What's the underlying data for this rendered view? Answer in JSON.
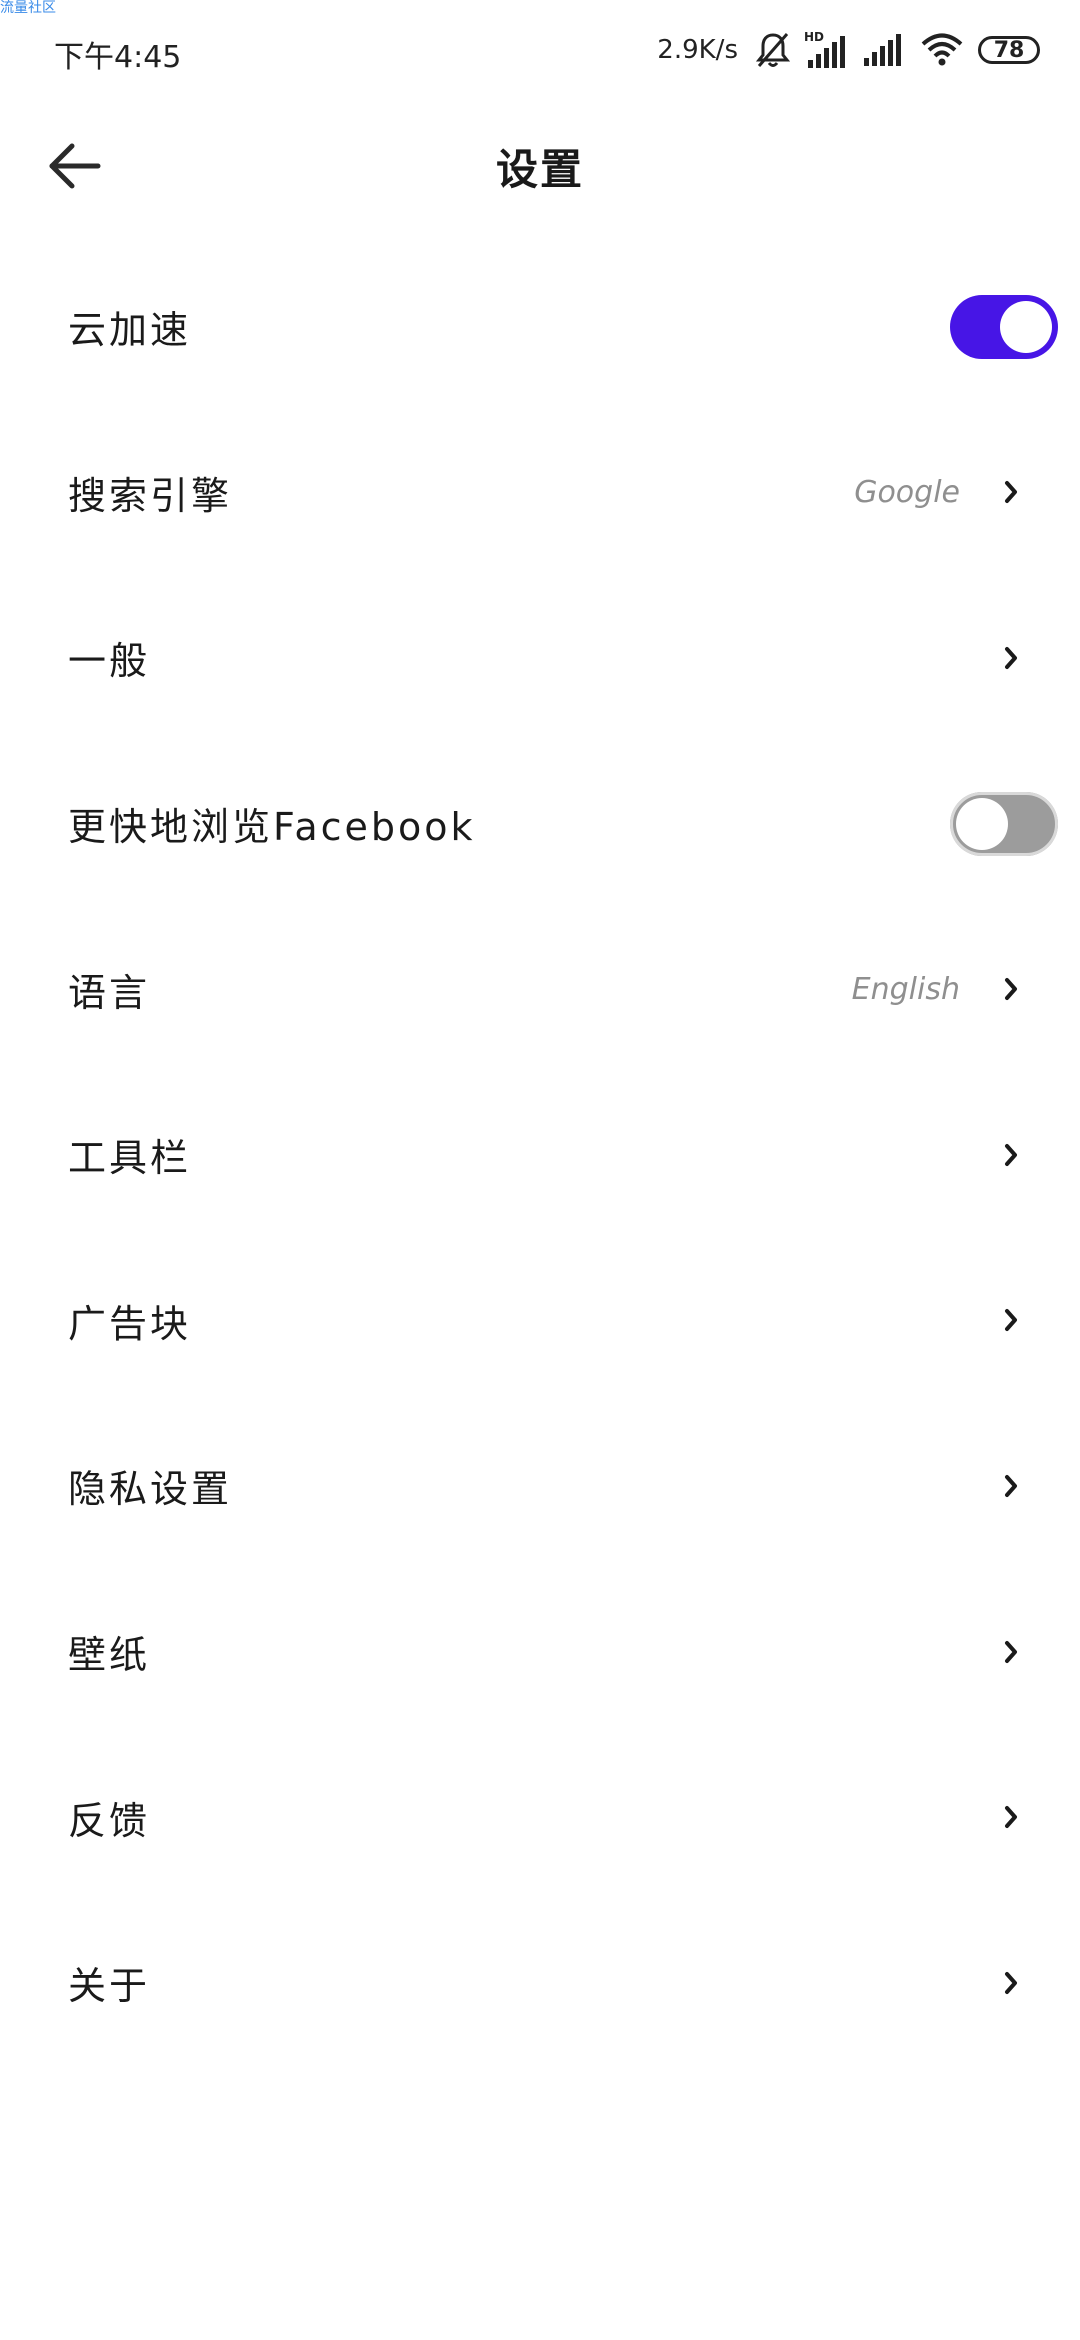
{
  "watermark": "流量社区",
  "status_bar": {
    "time": "下午4:45",
    "net_speed": "2.9K/s",
    "battery": "78",
    "icons": [
      "bell-muted-icon",
      "signal-hd-icon",
      "signal-icon",
      "wifi-icon",
      "battery-icon"
    ]
  },
  "header": {
    "title": "设置",
    "back_icon": "back-arrow-icon"
  },
  "settings": {
    "cloud_accel": {
      "label": "云加速",
      "toggle": "on"
    },
    "search_engine": {
      "label": "搜索引擎",
      "value": "Google"
    },
    "general": {
      "label": "一般"
    },
    "facebook": {
      "label": "更快地浏览Facebook",
      "toggle": "off"
    },
    "language": {
      "label": "语言",
      "value": "English"
    },
    "toolbar": {
      "label": "工具栏"
    },
    "adblock": {
      "label": "广告块"
    },
    "privacy": {
      "label": "隐私设置"
    },
    "wallpaper": {
      "label": "壁纸"
    },
    "feedback": {
      "label": "反馈"
    },
    "about": {
      "label": "关于"
    }
  },
  "colors": {
    "toggle_on": "#4715e6",
    "toggle_off": "#9c9c9c",
    "value_text": "#8f8f8f"
  }
}
